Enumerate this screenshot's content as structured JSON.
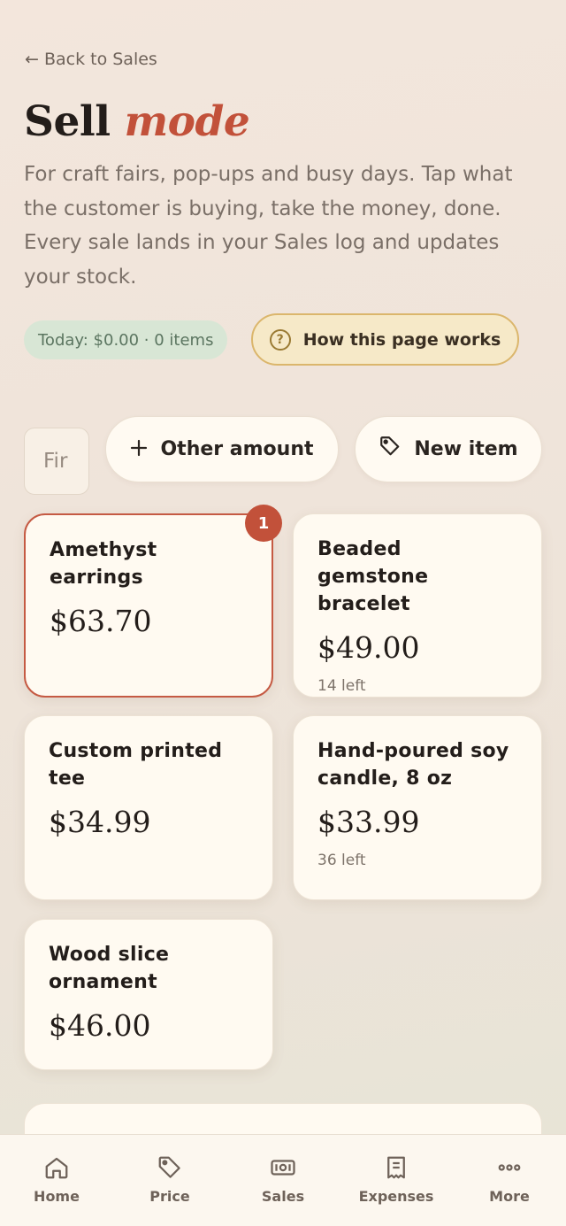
{
  "nav": {
    "back_label": "← Back to Sales"
  },
  "header": {
    "title_main": "Sell",
    "title_accent": "mode",
    "subtitle": "For craft fairs, pop-ups and busy days. Tap what the customer is buying, take the money, done. Every sale lands in your Sales log and updates your stock."
  },
  "stats": {
    "today_label": "Today: $0.00 · 0 items",
    "help_label": "How this page works",
    "help_icon": "?"
  },
  "search": {
    "value": "Fir"
  },
  "actions": {
    "other_amount_label": "Other amount",
    "new_item_label": "New item"
  },
  "products": [
    {
      "name": "Amethyst earrings",
      "price": "$63.70",
      "stock": "",
      "selected": true,
      "badge": "1"
    },
    {
      "name": "Beaded gemstone bracelet",
      "price": "$49.00",
      "stock": "14 left",
      "selected": false,
      "badge": ""
    },
    {
      "name": "Custom printed tee",
      "price": "$34.99",
      "stock": "",
      "selected": false,
      "badge": ""
    },
    {
      "name": "Hand-poured soy candle, 8 oz",
      "price": "$33.99",
      "stock": "36 left",
      "selected": false,
      "badge": ""
    },
    {
      "name": "Wood slice ornament",
      "price": "$46.00",
      "stock": "",
      "selected": false,
      "badge": ""
    }
  ],
  "tabs": [
    {
      "label": "Home",
      "icon": "home-icon"
    },
    {
      "label": "Price",
      "icon": "tag-icon"
    },
    {
      "label": "Sales",
      "icon": "cash-icon"
    },
    {
      "label": "Expenses",
      "icon": "receipt-icon"
    },
    {
      "label": "More",
      "icon": "more-icon"
    }
  ],
  "colors": {
    "accent": "#c2513a",
    "background": "#efe4da",
    "card": "#fffaf1",
    "today_pill": "#d8e6d5",
    "help_pill": "#f6e9c8"
  }
}
